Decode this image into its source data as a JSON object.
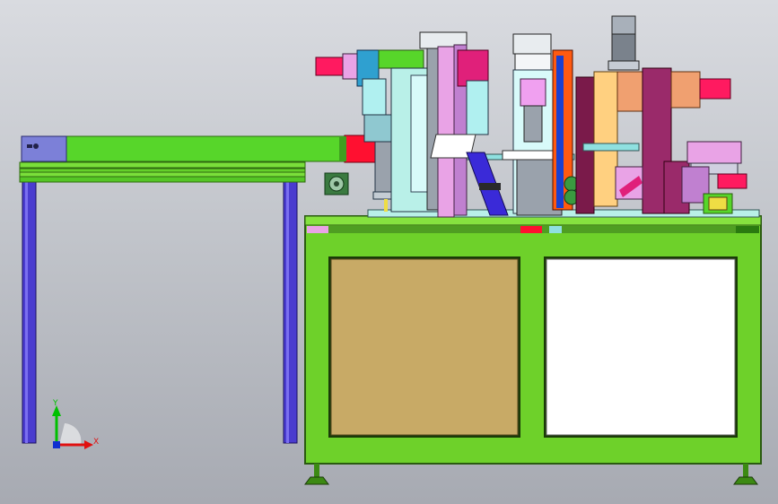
{
  "axes": {
    "y_label": "Y",
    "x_label": "X",
    "y_color": "#00c000",
    "x_color": "#e01010",
    "origin_color": "#1030d0"
  },
  "colors": {
    "frame": "#6ed12a",
    "frame_dark": "#3c8a12",
    "leg": "#4a3ccf",
    "conveyor": "#57d62a",
    "panel_left": "#c8aa66",
    "panel_right": "#ffffff",
    "accent_red": "#ff1030",
    "accent_magenta": "#e0207a",
    "accent_pink": "#e9a3e6",
    "accent_cyan": "#8fe0e0",
    "accent_orange": "#f0a070",
    "accent_maroon": "#7a1a4a",
    "steel": "#9aa2ac"
  }
}
